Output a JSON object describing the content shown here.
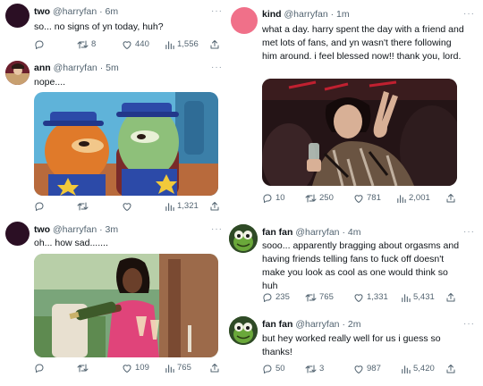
{
  "tweets": [
    {
      "name": "two",
      "handle": "@harryfan",
      "time": "6m",
      "text": "so... no signs of yn today, huh?",
      "replies": "",
      "retweets": "8",
      "likes": "440",
      "views": "1,556"
    },
    {
      "name": "ann",
      "handle": "@harryfan",
      "time": "5m",
      "text": "nope....",
      "media": "cartoon-fish-meme-image",
      "replies": "",
      "retweets": "",
      "likes": "",
      "views": "1,321"
    },
    {
      "name": "two",
      "handle": "@harryfan",
      "time": "3m",
      "text": "oh... how sad.......",
      "media": "woman-pouring-champagne-image",
      "replies": "",
      "retweets": "",
      "likes": "109",
      "views": "765"
    },
    {
      "name": "kind",
      "handle": "@harryfan",
      "time": "1m",
      "text": "what a day. harry spent the day with a friend and met lots of fans, and yn wasn't there following him around. i feel blessed now!! thank you, lord.",
      "media": "woman-peace-sign-image",
      "replies": "10",
      "retweets": "250",
      "likes": "781",
      "views": "2,001"
    },
    {
      "name": "fan fan",
      "handle": "@harryfan",
      "time": "4m",
      "text": "sooo... apparently bragging about orgasms and having friends telling fans to fuck off doesn't make you look as cool as one would think so huh",
      "replies": "235",
      "retweets": "765",
      "likes": "1,331",
      "views": "5,431"
    },
    {
      "name": "fan fan",
      "handle": "@harryfan",
      "time": "2m",
      "text": "but hey worked really well for us i guess so thanks!",
      "replies": "50",
      "retweets": "3",
      "likes": "987",
      "views": "5,420"
    }
  ],
  "labels": {
    "dot": "·",
    "more": "···"
  },
  "colors": {
    "text_secondary": "#536471",
    "avatar_two": "#2b0f24",
    "avatar_kind": "#f07089",
    "avatar_frog": "#3f6f2f"
  }
}
